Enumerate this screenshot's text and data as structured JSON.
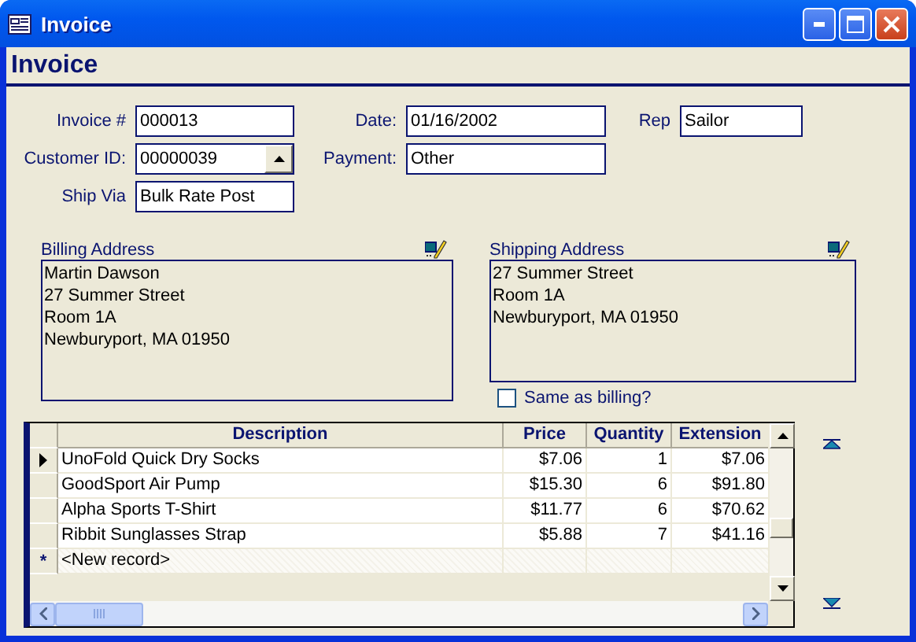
{
  "window": {
    "title": "Invoice"
  },
  "heading": "Invoice",
  "field_rows": [
    [
      {
        "label": "Invoice #",
        "value": "000013"
      },
      {
        "label": "Date:",
        "value": "01/16/2002"
      },
      {
        "label": "Rep",
        "value": "Sailor"
      }
    ],
    [
      {
        "label": "Customer ID:",
        "value": "00000039",
        "spinner": true
      },
      {
        "label": "Payment:",
        "value": "Other"
      }
    ],
    [
      {
        "label": "Ship Via",
        "value": "Bulk Rate Post"
      }
    ]
  ],
  "billing": {
    "label": "Billing Address",
    "lines": [
      "Martin Dawson",
      "27 Summer Street",
      "Room 1A",
      "Newburyport, MA 01950"
    ]
  },
  "shipping": {
    "label": "Shipping Address",
    "lines": [
      "27 Summer Street",
      "Room 1A",
      "Newburyport, MA 01950"
    ],
    "same_as_billing": {
      "label": "Same as billing?",
      "checked": false
    }
  },
  "table": {
    "columns": [
      "Description",
      "Price",
      "Quantity",
      "Extension"
    ],
    "rows": [
      {
        "selected": true,
        "cells": [
          "UnoFold Quick Dry Socks",
          "$7.06",
          "1",
          "$7.06"
        ]
      },
      {
        "selected": false,
        "cells": [
          "GoodSport Air Pump",
          "$15.30",
          "6",
          "$91.80"
        ]
      },
      {
        "selected": false,
        "cells": [
          "Alpha Sports T-Shirt",
          "$11.77",
          "6",
          "$70.62"
        ]
      },
      {
        "selected": false,
        "cells": [
          "Ribbit Sunglasses Strap",
          "$5.88",
          "7",
          "$41.16"
        ]
      }
    ],
    "new_record": {
      "marker": "*",
      "label": "<New record>"
    }
  }
}
